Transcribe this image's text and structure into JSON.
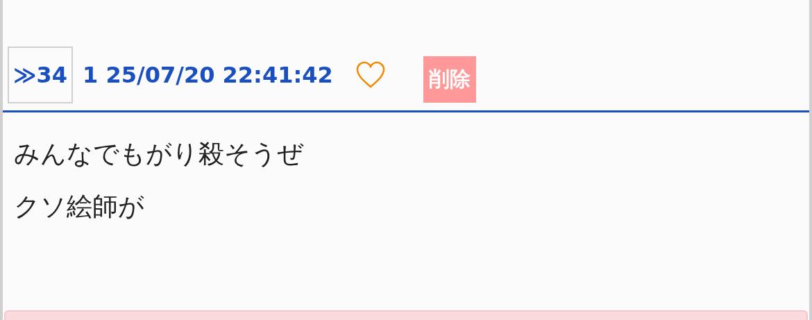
{
  "post": {
    "reply_link": "≫34",
    "meta": "1 25/07/20 22:41:42",
    "delete_label": "削除",
    "body": [
      "みんなでもがり殺そうぜ",
      "クソ絵師が"
    ]
  }
}
